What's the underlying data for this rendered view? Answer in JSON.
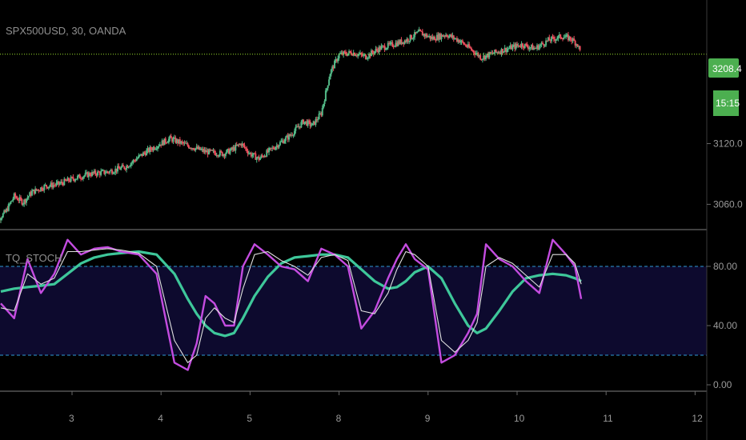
{
  "header": {
    "symbol_title": "SPX500USD, 30, OANDA"
  },
  "indicator": {
    "name": "TQ_STOCH"
  },
  "price_tag": {
    "value": "3208.4",
    "countdown": "15:15"
  },
  "colors": {
    "background": "#000000",
    "up_candle": "#53b987",
    "down_candle": "#eb4d5c",
    "price_line": "#9be22d",
    "tag_green": "#4caf50",
    "stoch_k": "#c44ce0",
    "stoch_d": "#e0e0e0",
    "stoch_slow": "#3ec79a",
    "band_line": "#2f9bd6",
    "band_fill": "#0d0a2e",
    "axis_line": "#555555"
  },
  "chart_data": [
    {
      "type": "candlestick",
      "title": "SPX500USD, 30, OANDA",
      "ylim": [
        3035,
        3262
      ],
      "y_ticks": [
        3060.0,
        3120.0
      ],
      "y_tick_labels": [
        "3060.0",
        "3120.0"
      ],
      "current_price": 3208.4,
      "price_path": [
        [
          2.1,
          3040
        ],
        [
          2.25,
          3052
        ],
        [
          2.35,
          3068
        ],
        [
          2.45,
          3062
        ],
        [
          2.55,
          3072
        ],
        [
          2.7,
          3078
        ],
        [
          2.85,
          3080
        ],
        [
          3.0,
          3085
        ],
        [
          3.2,
          3090
        ],
        [
          3.4,
          3092
        ],
        [
          3.6,
          3097
        ],
        [
          3.8,
          3110
        ],
        [
          3.95,
          3118
        ],
        [
          4.1,
          3125
        ],
        [
          4.3,
          3118
        ],
        [
          4.5,
          3112
        ],
        [
          4.7,
          3110
        ],
        [
          4.8,
          3114
        ],
        [
          4.9,
          3120
        ],
        [
          5.0,
          3110
        ],
        [
          5.1,
          3105
        ],
        [
          5.25,
          3115
        ],
        [
          5.45,
          3128
        ],
        [
          5.6,
          3142
        ],
        [
          5.7,
          3138
        ],
        [
          5.8,
          3150
        ],
        [
          5.9,
          3190
        ],
        [
          6.0,
          3208
        ],
        [
          6.15,
          3210
        ],
        [
          6.3,
          3206
        ],
        [
          6.45,
          3214
        ],
        [
          6.6,
          3218
        ],
        [
          6.75,
          3222
        ],
        [
          6.9,
          3230
        ],
        [
          7.05,
          3224
        ],
        [
          7.2,
          3228
        ],
        [
          7.35,
          3222
        ],
        [
          7.5,
          3212
        ],
        [
          7.6,
          3205
        ],
        [
          7.75,
          3210
        ],
        [
          7.9,
          3214
        ],
        [
          8.05,
          3218
        ],
        [
          8.2,
          3214
        ],
        [
          8.35,
          3222
        ],
        [
          8.5,
          3226
        ],
        [
          8.6,
          3224
        ],
        [
          8.68,
          3218
        ],
        [
          8.72,
          3208.4
        ]
      ]
    },
    {
      "type": "line",
      "title": "TQ_STOCH",
      "ylim": [
        0,
        100
      ],
      "y_ticks": [
        0,
        40,
        80
      ],
      "y_tick_labels": [
        "0.00",
        "40.00",
        "80.00"
      ],
      "bands": [
        20,
        80
      ],
      "x_tick_labels": [
        "3",
        "4",
        "5",
        "8",
        "9",
        "10",
        "11",
        "12"
      ],
      "x_tick_values": [
        3,
        4,
        5,
        6,
        7,
        8,
        9,
        10
      ],
      "xlim": [
        2.2,
        10.1
      ],
      "series": [
        {
          "key": "k",
          "x": [
            2.2,
            2.35,
            2.5,
            2.65,
            2.8,
            2.95,
            3.1,
            3.25,
            3.4,
            3.55,
            3.75,
            3.95,
            4.15,
            4.3,
            4.4,
            4.5,
            4.6,
            4.72,
            4.82,
            4.92,
            5.05,
            5.2,
            5.35,
            5.5,
            5.65,
            5.8,
            5.95,
            6.1,
            6.25,
            6.4,
            6.55,
            6.65,
            6.75,
            6.85,
            7.0,
            7.15,
            7.3,
            7.45,
            7.55,
            7.65,
            7.8,
            7.95,
            8.1,
            8.25,
            8.4,
            8.55,
            8.65,
            8.72
          ],
          "values": [
            55,
            45,
            85,
            62,
            75,
            98,
            88,
            92,
            93,
            90,
            88,
            75,
            15,
            10,
            28,
            60,
            55,
            40,
            40,
            80,
            95,
            88,
            80,
            78,
            70,
            92,
            88,
            80,
            38,
            50,
            72,
            85,
            95,
            85,
            78,
            15,
            20,
            35,
            48,
            95,
            85,
            80,
            70,
            62,
            98,
            88,
            80,
            58
          ]
        },
        {
          "key": "d",
          "x": [
            2.2,
            2.35,
            2.5,
            2.65,
            2.8,
            2.95,
            3.1,
            3.25,
            3.4,
            3.55,
            3.75,
            3.95,
            4.15,
            4.3,
            4.4,
            4.5,
            4.6,
            4.72,
            4.82,
            4.92,
            5.05,
            5.2,
            5.35,
            5.5,
            5.65,
            5.8,
            5.95,
            6.1,
            6.25,
            6.4,
            6.55,
            6.65,
            6.75,
            6.85,
            7.0,
            7.15,
            7.3,
            7.45,
            7.55,
            7.65,
            7.8,
            7.95,
            8.1,
            8.25,
            8.4,
            8.55,
            8.65,
            8.72
          ],
          "values": [
            52,
            50,
            75,
            68,
            72,
            90,
            90,
            91,
            92,
            91,
            89,
            80,
            30,
            15,
            20,
            45,
            52,
            45,
            42,
            65,
            88,
            90,
            84,
            80,
            74,
            86,
            88,
            84,
            50,
            48,
            62,
            78,
            90,
            88,
            80,
            30,
            22,
            30,
            42,
            80,
            86,
            82,
            74,
            66,
            88,
            88,
            82,
            68
          ]
        },
        {
          "key": "slow",
          "x": [
            2.2,
            2.35,
            2.5,
            2.65,
            2.8,
            2.95,
            3.1,
            3.25,
            3.4,
            3.55,
            3.75,
            3.95,
            4.15,
            4.3,
            4.4,
            4.5,
            4.6,
            4.72,
            4.82,
            4.92,
            5.05,
            5.2,
            5.35,
            5.5,
            5.65,
            5.8,
            5.95,
            6.1,
            6.25,
            6.4,
            6.55,
            6.65,
            6.75,
            6.85,
            7.0,
            7.15,
            7.3,
            7.45,
            7.55,
            7.65,
            7.8,
            7.95,
            8.1,
            8.25,
            8.4,
            8.55,
            8.65,
            8.72
          ],
          "values": [
            63,
            65,
            66,
            67,
            68,
            75,
            82,
            86,
            88,
            89,
            90,
            88,
            75,
            58,
            48,
            40,
            35,
            33,
            35,
            45,
            60,
            73,
            82,
            86,
            87,
            88,
            88,
            86,
            78,
            70,
            65,
            66,
            70,
            76,
            80,
            72,
            55,
            40,
            35,
            38,
            50,
            63,
            72,
            74,
            75,
            74,
            72,
            70
          ]
        }
      ]
    }
  ]
}
